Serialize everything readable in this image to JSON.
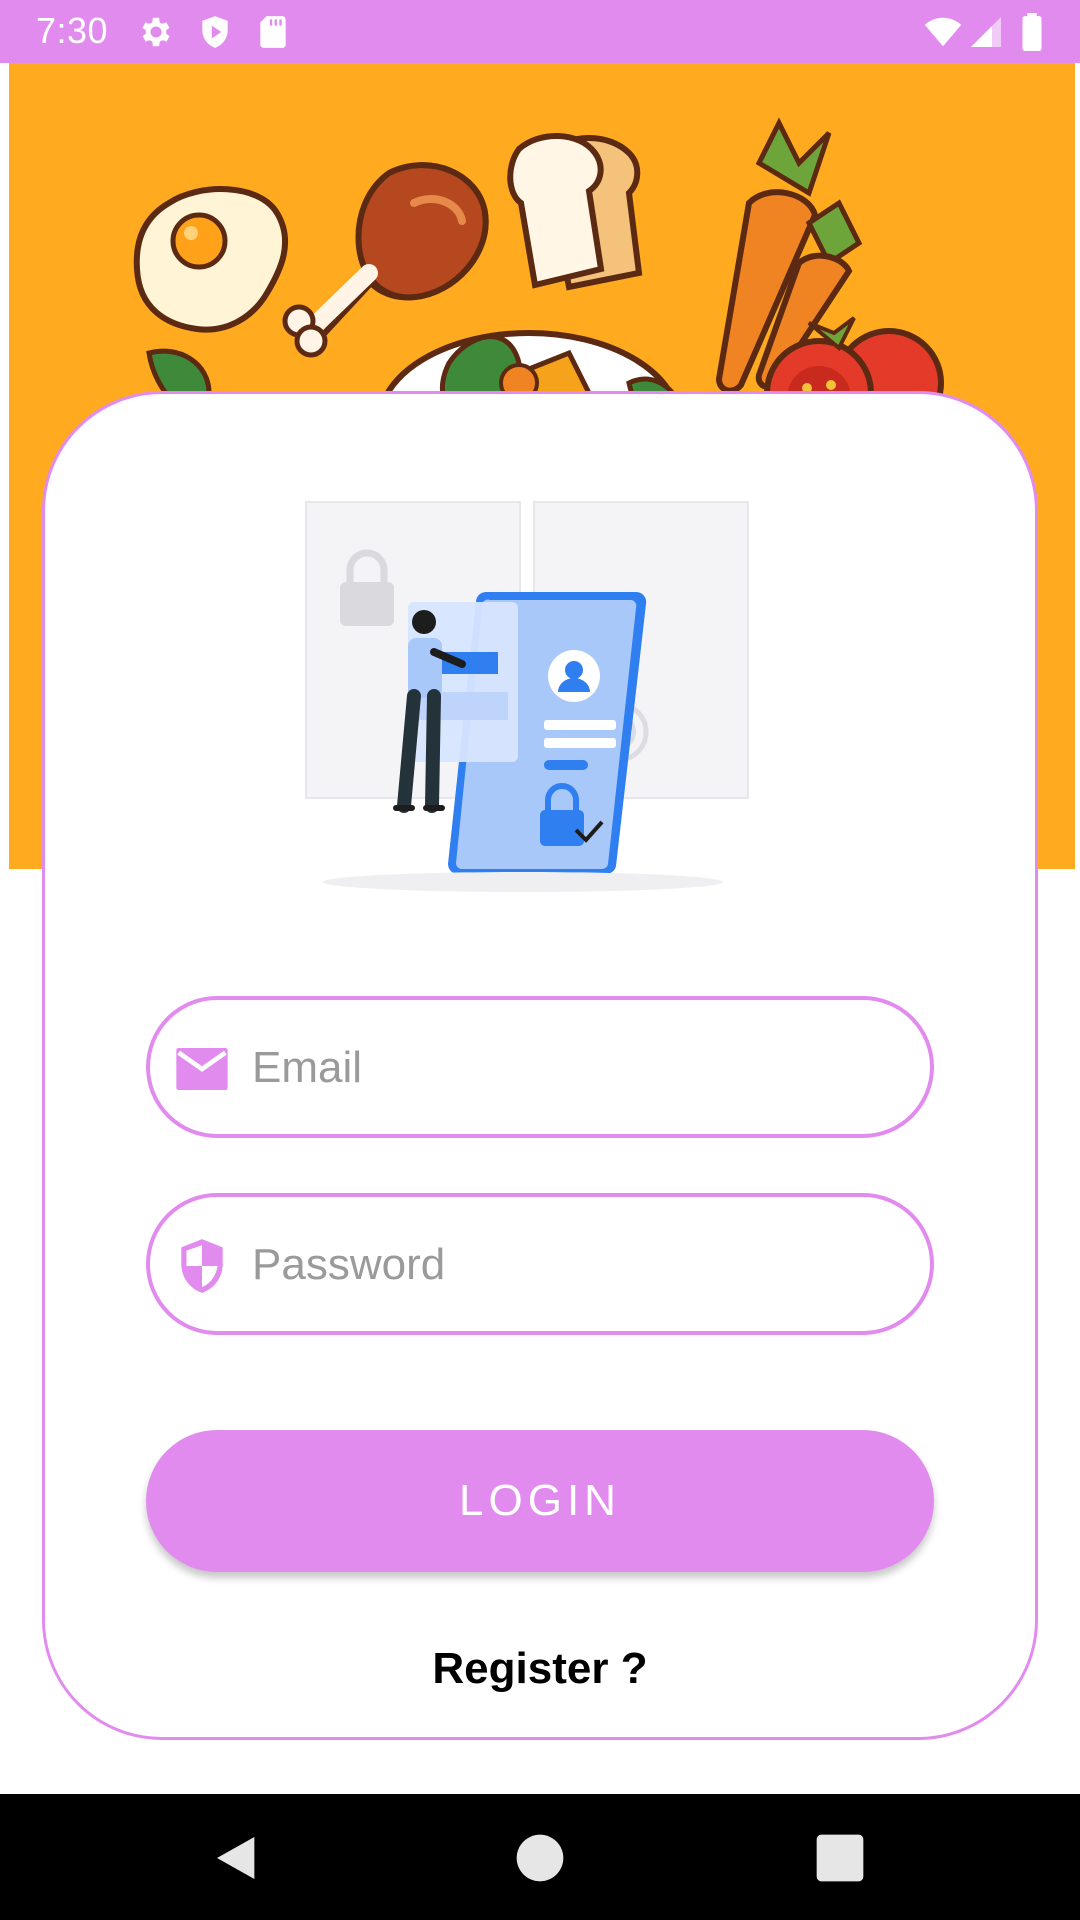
{
  "status_bar": {
    "time": "7:30",
    "icons": [
      "gear-icon",
      "play-protect-icon",
      "sd-card-icon",
      "wifi-icon",
      "signal-icon",
      "battery-icon"
    ],
    "background": "#e28bef"
  },
  "banner": {
    "background": "#ffaa1f",
    "illustrations": [
      "fried-egg",
      "chicken-drumstick",
      "bread-slices",
      "carrots",
      "salad-bowl",
      "tomatoes"
    ]
  },
  "login": {
    "email_placeholder": "Email",
    "password_placeholder": "Password",
    "login_label": "LOGIN",
    "register_label": "Register ?",
    "accent": "#e28bef"
  },
  "nav_bar": {
    "buttons": [
      "back-icon",
      "home-icon",
      "recents-icon"
    ]
  }
}
